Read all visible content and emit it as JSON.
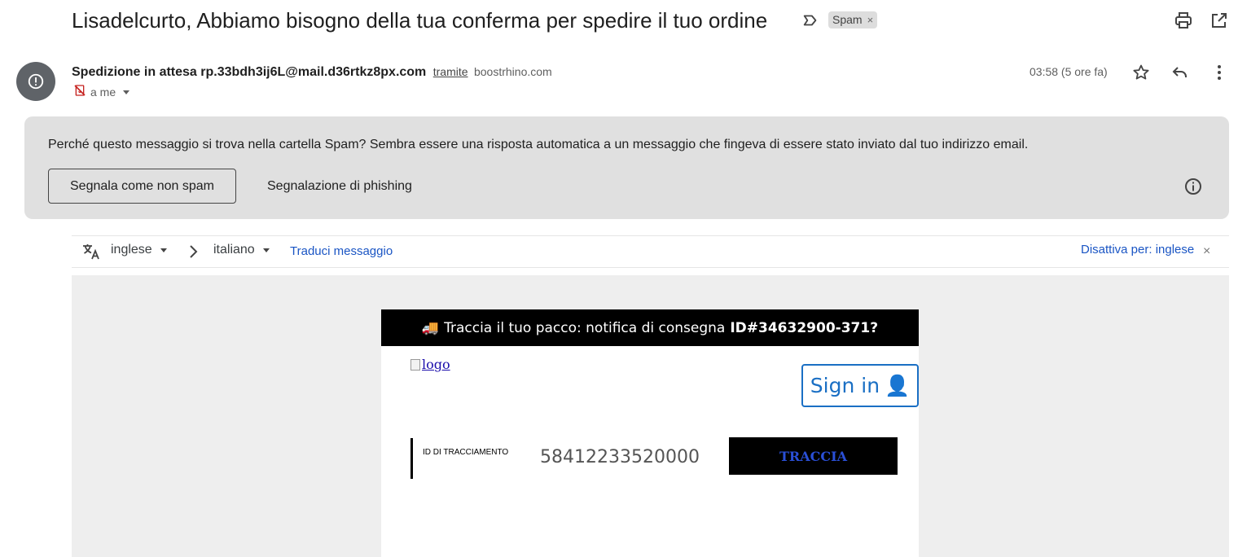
{
  "email": {
    "subject": "Lisadelcurto, Abbiamo bisogno della tua conferma per spedire il tuo ordine",
    "label": "Spam",
    "label_remove": "×",
    "sender_name": "Spedizione in attesa rp.33bdh3ij6L@mail.d36rtkz8px.com",
    "via_label": "tramite",
    "via_domain": "boostrhino.com",
    "recipient": "a me",
    "time": "03:58 (5 ore fa)"
  },
  "icons": {
    "important": "label-important-icon",
    "print": "print-icon",
    "open_new_window": "open-in-new-icon",
    "avatar": "warning-circle-icon",
    "no_encryption": "no-encryption-icon",
    "star": "star-icon",
    "reply": "reply-icon",
    "more": "more-vert-icon",
    "info": "info-icon",
    "translate": "translate-icon"
  },
  "spam_banner": {
    "question": "Perché questo messaggio si trova nella cartella Spam?",
    "explanation": " Sembra essere una risposta automatica a un messaggio che fingeva di essere stato inviato dal tuo indirizzo email.",
    "not_spam_button": "Segnala come non spam",
    "phishing_button": "Segnalazione di phishing"
  },
  "translate": {
    "source_lang": "inglese",
    "target_lang": "italiano",
    "translate_link": "Traduci messaggio",
    "disable_link": "Disattiva per: inglese",
    "close": "×"
  },
  "message": {
    "header_emoji": "🚚",
    "header_text": "Traccia il tuo pacco: notifica di consegna",
    "header_id": "ID#34632900-371?",
    "logo_alt": "logo",
    "sign_in": "Sign in",
    "sign_in_emoji": "👤",
    "tracking_label": "ID DI TRACCIAMENTO",
    "tracking_number": "58412233520000",
    "track_button": "TRACCIA"
  },
  "colors": {
    "link": "#1a55c4",
    "banner_bg": "#e0e0e0",
    "avatar_bg": "#5f6368",
    "sign_in": "#1a6fc4",
    "track_button_text": "#2a4fd6"
  }
}
